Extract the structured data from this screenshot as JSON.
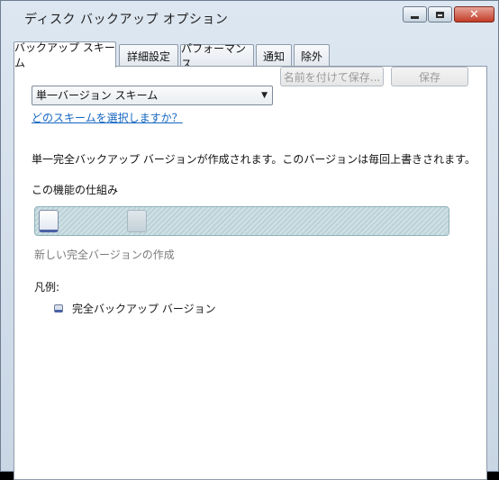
{
  "window": {
    "title": "ディスク バックアップ オプション",
    "close_glyph": "✕"
  },
  "tabs": [
    {
      "label": "バックアップ スキーム",
      "active": true
    },
    {
      "label": "詳細設定",
      "active": false
    },
    {
      "label": "パフォーマンス",
      "active": false
    },
    {
      "label": "通知",
      "active": false
    },
    {
      "label": "除外",
      "active": false
    }
  ],
  "scheme": {
    "selected": "単一バージョン スキーム",
    "arrow": "▼",
    "save_as_label": "名前を付けて保存...",
    "save_label": "保存",
    "help_link": "どのスキームを選択しますか？"
  },
  "description": "単一完全バックアップ バージョンが作成されます。このバージョンは毎回上書きされます。",
  "how_it_works": {
    "title": "この機能の仕組み",
    "caption": "新しい完全バージョンの作成"
  },
  "legend": {
    "title": "凡例:",
    "items": [
      {
        "label": "完全バックアップ バージョン"
      }
    ]
  },
  "colors": {
    "link": "#1565c0",
    "full_backup_accent": "#4a62a6",
    "track_fill": "#cfe1e5"
  }
}
